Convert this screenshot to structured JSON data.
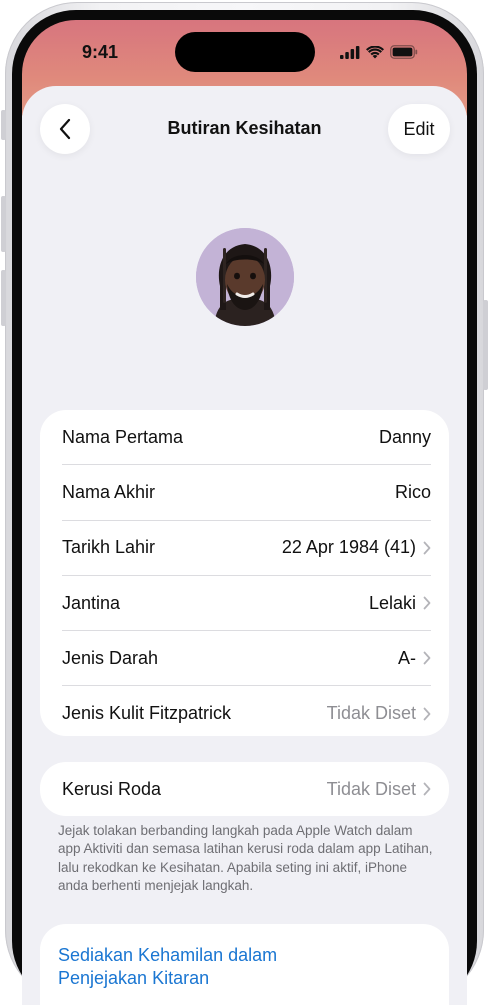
{
  "status_bar": {
    "time": "9:41",
    "icons": [
      "cellular-signal-icon",
      "wifi-icon",
      "battery-icon"
    ]
  },
  "nav": {
    "back_icon": "chevron-left-icon",
    "title": "Butiran Kesihatan",
    "edit_label": "Edit"
  },
  "profile": {
    "avatar": "memoji-avatar"
  },
  "details": [
    {
      "label": "Nama Pertama",
      "value": "Danny",
      "has_chevron": false,
      "muted": false
    },
    {
      "label": "Nama Akhir",
      "value": "Rico",
      "has_chevron": false,
      "muted": false
    },
    {
      "label": "Tarikh Lahir",
      "value": "22 Apr 1984 (41)",
      "has_chevron": true,
      "muted": false
    },
    {
      "label": "Jantina",
      "value": "Lelaki",
      "has_chevron": true,
      "muted": false
    },
    {
      "label": "Jenis Darah",
      "value": "A-",
      "has_chevron": true,
      "muted": false
    },
    {
      "label": "Jenis Kulit Fitzpatrick",
      "value": "Tidak Diset",
      "has_chevron": true,
      "muted": true
    }
  ],
  "wheelchair": {
    "label": "Kerusi Roda",
    "value": "Tidak Diset",
    "footnote": "Jejak tolakan berbanding langkah pada Apple Watch dalam app Aktiviti dan semasa latihan kerusi roda dalam app Latihan, lalu rekodkan ke Kesihatan. Apabila seting ini aktif, iPhone anda berhenti menjejak langkah."
  },
  "pregnancy": {
    "link_label": "Sediakan Kehamilan dalam Penjejakan Kitaran"
  },
  "colors": {
    "accent_link": "#1a76d2",
    "header_gradient_top": "#d7757e",
    "header_gradient_bottom": "#e39a86",
    "background": "#f0f0f5"
  }
}
